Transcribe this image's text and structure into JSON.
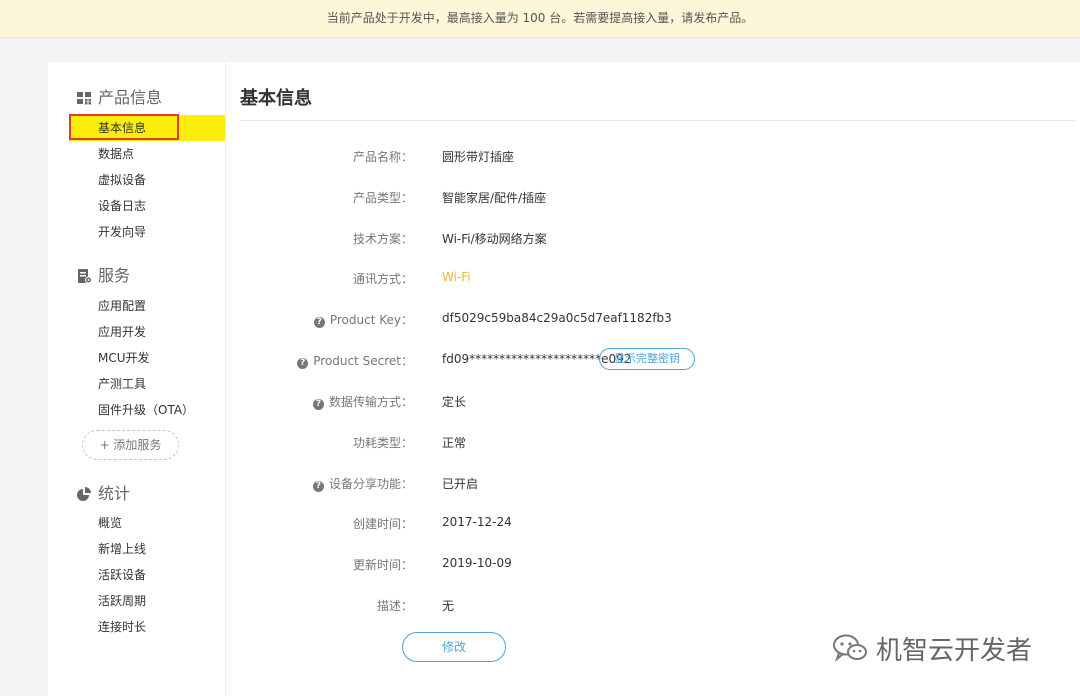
{
  "banner": {
    "text": "当前产品处于开发中，最高接入量为 100 台。若需要提高接入量，请发布产品。"
  },
  "sidebar": {
    "groups": [
      {
        "title": "产品信息",
        "icon": "grid-icon",
        "items": [
          "基本信息",
          "数据点",
          "虚拟设备",
          "设备日志",
          "开发向导"
        ]
      },
      {
        "title": "服务",
        "icon": "service-icon",
        "items": [
          "应用配置",
          "应用开发",
          "MCU开发",
          "产测工具",
          "固件升级（OTA）"
        ]
      },
      {
        "title": "统计",
        "icon": "pie-chart-icon",
        "items": [
          "概览",
          "新增上线",
          "活跃设备",
          "活跃周期",
          "连接时长"
        ]
      }
    ],
    "active_item": "基本信息",
    "add_service_label": "+ 添加服务"
  },
  "content": {
    "title": "基本信息",
    "rows": [
      {
        "label": "产品名称：",
        "value": "圆形带灯插座",
        "help": false
      },
      {
        "label": "产品类型：",
        "value": "智能家居/配件/插座",
        "help": false
      },
      {
        "label": "技术方案：",
        "value": "Wi-Fi/移动网络方案",
        "help": false
      },
      {
        "label": "通讯方式：",
        "value": "Wi-Fi",
        "help": false,
        "accent": true
      },
      {
        "label": "Product Key：",
        "value": "df5029c59ba84c29a0c5d7eaf1182fb3",
        "help": true
      },
      {
        "label": "Product Secret：",
        "value": "fd09**********************e092",
        "help": true
      },
      {
        "label": "数据传输方式：",
        "value": "定长",
        "help": true
      },
      {
        "label": "功耗类型：",
        "value": "正常",
        "help": false
      },
      {
        "label": "设备分享功能：",
        "value": "已开启",
        "help": true
      },
      {
        "label": "创建时间：",
        "value": "2017-12-24",
        "help": false
      },
      {
        "label": "更新时间：",
        "value": "2019-10-09",
        "help": false
      },
      {
        "label": "描述：",
        "value": "无",
        "help": false
      }
    ],
    "show_secret_label": "显示完整密钥",
    "edit_label": "修改"
  },
  "watermark": {
    "text": "机智云开发者",
    "icon": "wechat-icon"
  },
  "colors": {
    "accent": "#f3b23c",
    "link": "#4fa3e0",
    "highlight": "#fcee0a",
    "marker": "#e13c34"
  }
}
